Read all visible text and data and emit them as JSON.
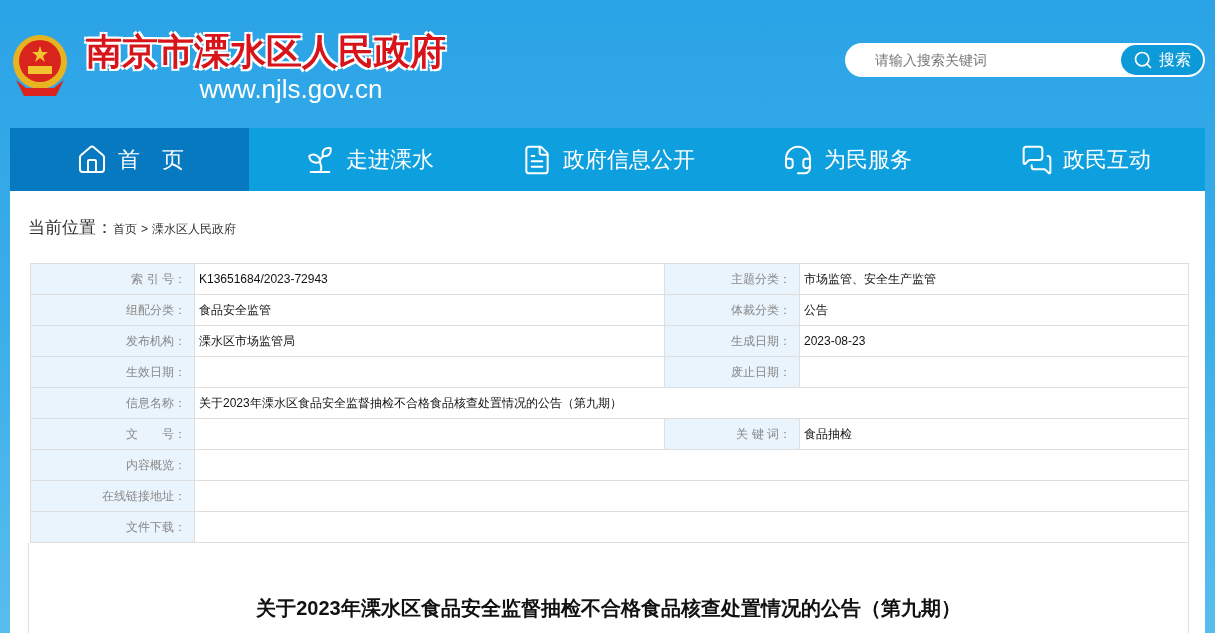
{
  "header": {
    "site_name": "南京市溧水区人民政府",
    "site_url": "www.njls.gov.cn",
    "search": {
      "placeholder": "请输入搜索关键词",
      "button": "搜索"
    }
  },
  "nav": [
    {
      "label": "首　页",
      "selected": true,
      "kind": "home"
    },
    {
      "label": "走进溧水",
      "selected": false,
      "kind": "intro"
    },
    {
      "label": "政府信息公开",
      "selected": false,
      "kind": "info"
    },
    {
      "label": "为民服务",
      "selected": false,
      "kind": "service"
    },
    {
      "label": "政民互动",
      "selected": false,
      "kind": "interaction"
    }
  ],
  "breadcrumb": {
    "label": "当前位置：",
    "items": [
      "首页",
      "溧水区人民政府"
    ],
    "separator": ">"
  },
  "info_table": [
    {
      "cells": [
        {
          "label": "索 引 号：",
          "value": "K13651684/2023-72943"
        },
        {
          "label": "主题分类：",
          "value": "市场监管、安全生产监管"
        }
      ]
    },
    {
      "cells": [
        {
          "label": "组配分类：",
          "value": "食品安全监管"
        },
        {
          "label": "体裁分类：",
          "value": "公告"
        }
      ]
    },
    {
      "cells": [
        {
          "label": "发布机构：",
          "value": "溧水区市场监管局"
        },
        {
          "label": "生成日期：",
          "value": "2023-08-23"
        }
      ]
    },
    {
      "cells": [
        {
          "label": "生效日期："
        },
        {
          "label": "废止日期："
        }
      ]
    },
    {
      "cells": [
        {
          "label": "信息名称：",
          "value": "关于2023年溧水区食品安全监督抽检不合格食品核查处置情况的公告（第九期）"
        }
      ]
    },
    {
      "cells": [
        {
          "label": "文　　号："
        },
        {
          "label": "关 键 词：",
          "value": "食品抽检"
        }
      ]
    },
    {
      "cells": [
        {
          "label": "内容概览："
        }
      ]
    },
    {
      "cells": [
        {
          "label": "在线链接地址："
        }
      ]
    },
    {
      "cells": [
        {
          "label": "文件下载："
        }
      ]
    }
  ],
  "article": {
    "title": "关于2023年溧水区食品安全监督抽检不合格食品核查处置情况的公告（第九期）"
  }
}
